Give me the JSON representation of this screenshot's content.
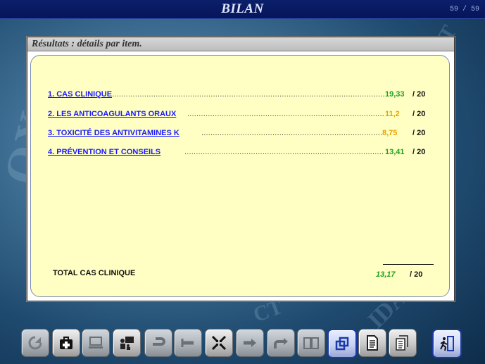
{
  "app": {
    "title": "BILAN",
    "page_counter": "59 / 59"
  },
  "panel": {
    "header": "Résultats : détails par item.",
    "items": [
      {
        "label": "1. CAS CLINIQUE",
        "score": "19,33",
        "max": "/ 20",
        "score_color": "#22a022"
      },
      {
        "label": "2. LES ANTICOAGULANTS ORAUX",
        "score": "11,2",
        "max": "/ 20",
        "score_color": "#e6a300"
      },
      {
        "label": "3. TOXICITÉ DES ANTIVITAMINES K",
        "score": "8,75",
        "max": "/ 20",
        "score_color": "#e6a300"
      },
      {
        "label": "4. PRÉVENTION ET CONSEILS",
        "score": "13,41",
        "max": "/ 20",
        "score_color": "#22a022"
      }
    ],
    "total": {
      "label": "TOTAL CAS CLINIQUE",
      "score": "13,17",
      "max": "/ 20"
    }
  },
  "toolbar": {
    "buttons": [
      {
        "name": "reload-icon",
        "state": "dim"
      },
      {
        "name": "first-aid-kit-icon",
        "state": "normal"
      },
      {
        "name": "computer-icon",
        "state": "dim"
      },
      {
        "name": "teacher-board-icon",
        "state": "normal"
      },
      {
        "name": "return-arrow-icon",
        "state": "dim"
      },
      {
        "name": "back-arrow-icon",
        "state": "dim"
      },
      {
        "name": "collapse-arrows-icon",
        "state": "normal"
      },
      {
        "name": "forward-arrow-icon",
        "state": "dim"
      },
      {
        "name": "redo-arrow-icon",
        "state": "dim"
      },
      {
        "name": "book-icon",
        "state": "dim"
      },
      {
        "name": "windows-icon",
        "state": "selected"
      },
      {
        "name": "document-icon",
        "state": "normal"
      },
      {
        "name": "documents-stack-icon",
        "state": "normal"
      },
      {
        "name": "exit-door-icon",
        "state": "exit"
      }
    ]
  },
  "colors": {
    "accent_green": "#22a022",
    "accent_orange": "#e6a300",
    "link_blue": "#1a1aff",
    "title_bar": "#07155a"
  }
}
